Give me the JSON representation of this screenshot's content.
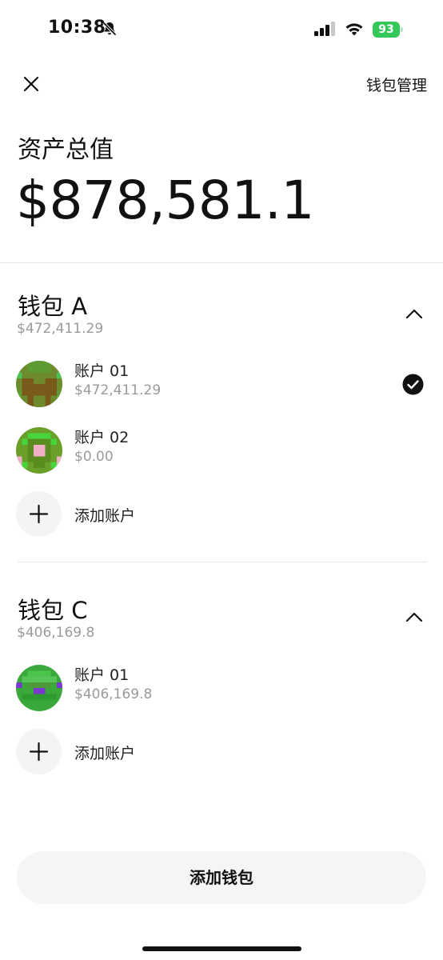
{
  "status_bar": {
    "time": "10:38",
    "battery": "93"
  },
  "header": {
    "wallet_manage": "钱包管理"
  },
  "total": {
    "label": "资产总值",
    "value": "$878,581.1"
  },
  "wallets": [
    {
      "name": "钱包 A",
      "total": "$472,411.29",
      "accounts": [
        {
          "name": "账户 01",
          "balance": "$472,411.29",
          "selected": true
        },
        {
          "name": "账户 02",
          "balance": "$0.00",
          "selected": false
        }
      ],
      "add_account": "添加账户"
    },
    {
      "name": "钱包 C",
      "total": "$406,169.8",
      "accounts": [
        {
          "name": "账户 01",
          "balance": "$406,169.8",
          "selected": false
        }
      ],
      "add_account": "添加账户"
    }
  ],
  "add_wallet": "添加钱包",
  "colors": {
    "battery": "#34c759",
    "muted_text": "#9a9a9a",
    "button_bg": "#f5f5f5"
  }
}
